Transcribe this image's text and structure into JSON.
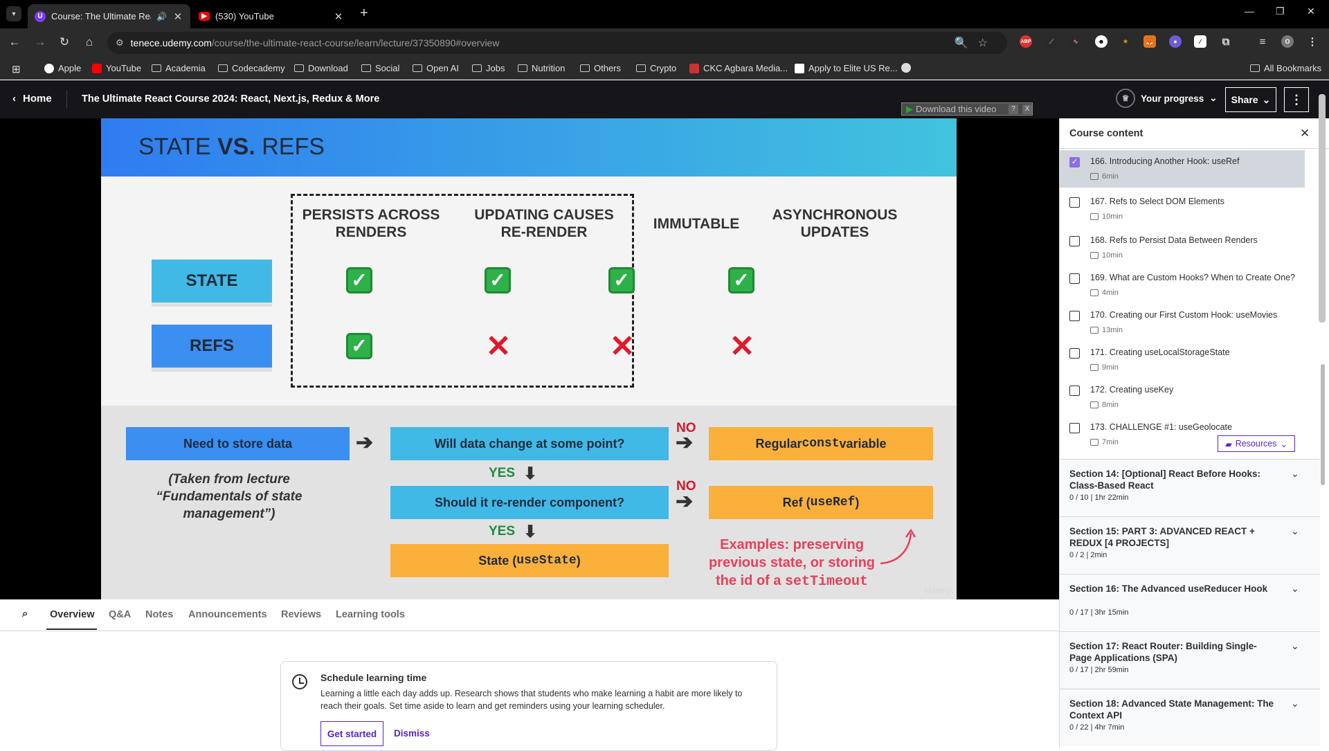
{
  "browser": {
    "tabs": [
      {
        "title": "Course: The Ultimate React",
        "active": true
      },
      {
        "title": "(530) YouTube",
        "active": false
      }
    ],
    "url_host": "tenece.udemy.com",
    "url_path": "/course/the-ultimate-react-course/learn/lecture/37350890#overview",
    "bookmarks": [
      "Apple",
      "YouTube",
      "Academia",
      "Codecademy",
      "Download",
      "Social",
      "Open AI",
      "Jobs",
      "Nutrition",
      "Others",
      "Crypto",
      "CKC Agbara Media...",
      "Apply to Elite US Re..."
    ],
    "all_bookmarks": "All Bookmarks",
    "profile_initial": "O",
    "ext_abp": "ABP"
  },
  "header": {
    "home": "Home",
    "course_title": "The Ultimate React Course 2024: React, Next.js, Redux & More",
    "progress": "Your progress",
    "share": "Share",
    "download": "Download this video",
    "download_help": "?",
    "download_close": "X"
  },
  "slide": {
    "title_a": "STATE",
    "title_vs": "VS.",
    "title_b": "REFS",
    "columns": [
      "PERSISTS ACROSS RENDERS",
      "UPDATING CAUSES RE-RENDER",
      "IMMUTABLE",
      "ASYNCHRONOUS UPDATES"
    ],
    "rows": [
      {
        "label": "STATE",
        "values": [
          true,
          true,
          true,
          true
        ]
      },
      {
        "label": "REFS",
        "values": [
          true,
          false,
          false,
          false
        ]
      }
    ],
    "flow": {
      "start": "Need to store data",
      "q1": "Will data change at some point?",
      "q2": "Should it re-render component?",
      "r1_text": "Regular ",
      "r1_code": "const",
      "r1_tail": " variable",
      "r2_text": "Ref (",
      "r2_code": "useRef",
      "r2_tail": ")",
      "r3_text": "State (",
      "r3_code": "useState",
      "r3_tail": ")",
      "yes": "YES",
      "no": "NO",
      "note": "(Taken from lecture “Fundamentals of state management”)",
      "examples": "Examples: preserving previous state, or storing the id of a ",
      "examples_code": "setTimeout"
    },
    "watermark": "Udemy"
  },
  "subtabs": [
    "Overview",
    "Q&A",
    "Notes",
    "Announcements",
    "Reviews",
    "Learning tools"
  ],
  "schedule": {
    "title": "Schedule learning time",
    "body": "Learning a little each day adds up. Research shows that students who make learning a habit are more likely to reach their goals. Set time aside to learn and get reminders using your learning scheduler.",
    "primary": "Get started",
    "secondary": "Dismiss"
  },
  "sidebar": {
    "title": "Course content",
    "lectures": [
      {
        "title": "166. Introducing Another Hook: useRef",
        "duration": "6min",
        "done": true,
        "current": true
      },
      {
        "title": "167. Refs to Select DOM Elements",
        "duration": "10min",
        "done": false
      },
      {
        "title": "168. Refs to Persist Data Between Renders",
        "duration": "10min",
        "done": false
      },
      {
        "title": "169. What are Custom Hooks? When to Create One?",
        "duration": "4min",
        "done": false
      },
      {
        "title": "170. Creating our First Custom Hook: useMovies",
        "duration": "13min",
        "done": false
      },
      {
        "title": "171. Creating useLocalStorageState",
        "duration": "9min",
        "done": false
      },
      {
        "title": "172. Creating useKey",
        "duration": "8min",
        "done": false
      },
      {
        "title": "173. CHALLENGE #1: useGeolocate",
        "duration": "7min",
        "done": false,
        "resources": "Resources"
      }
    ],
    "sections": [
      {
        "title": "Section 14: [Optional] React Before Hooks: Class-Based React",
        "meta": "0 / 10 | 1hr 22min"
      },
      {
        "title": "Section 15: PART 3: ADVANCED REACT + REDUX [4 PROJECTS]",
        "meta": "0 / 2 | 2min"
      },
      {
        "title": "Section 16: The Advanced useReducer Hook",
        "meta": "0 / 17 | 3hr 15min"
      },
      {
        "title": "Section 17: React Router: Building Single-Page Applications (SPA)",
        "meta": "0 / 17 | 2hr 59min"
      },
      {
        "title": "Section 18: Advanced State Management: The Context API",
        "meta": "0 / 22 | 4hr 7min"
      }
    ]
  },
  "colors": {
    "accent": "#5624d0",
    "check": "#2fb14a",
    "cross": "#e0192b",
    "boxBlue": "#3a8ff0",
    "boxCyan": "#41b9e6",
    "boxOrange": "#fbb03b"
  }
}
